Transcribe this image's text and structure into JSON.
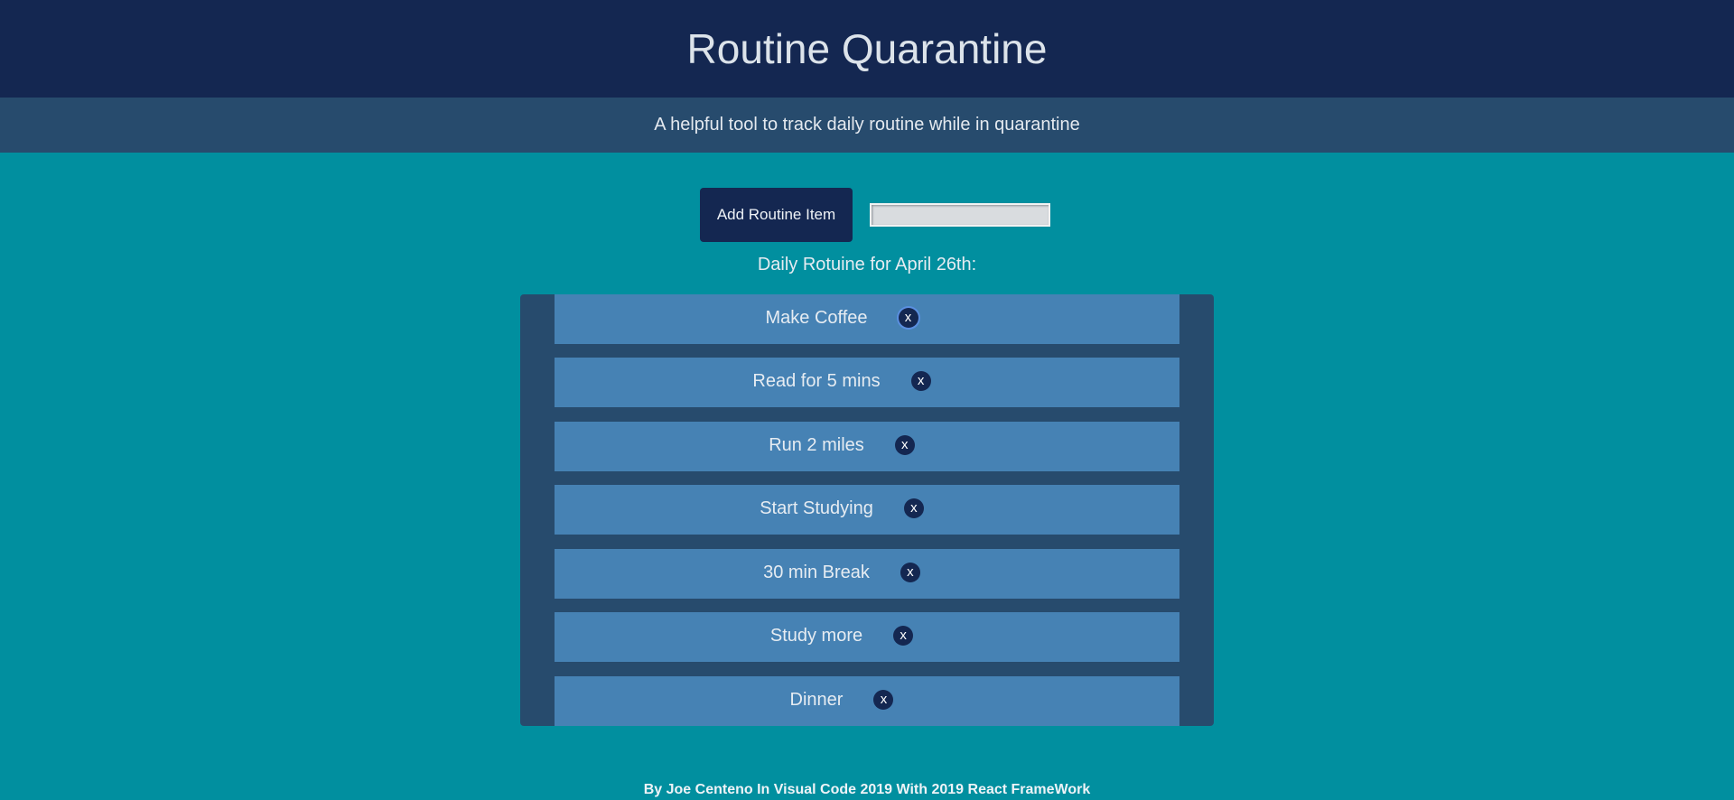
{
  "header": {
    "title": "Routine Quarantine"
  },
  "subheader": {
    "text": "A helpful tool to track daily routine while in quarantine"
  },
  "controls": {
    "add_button_label": "Add Routine Item",
    "input_value": "",
    "input_placeholder": ""
  },
  "list": {
    "heading": "Daily Rotuine for April 26th:",
    "delete_label": "x",
    "items": [
      {
        "label": "Make Coffee"
      },
      {
        "label": "Read for 5 mins"
      },
      {
        "label": "Run 2 miles"
      },
      {
        "label": "Start Studying"
      },
      {
        "label": "30 min Break"
      },
      {
        "label": "Study more"
      },
      {
        "label": "Dinner"
      }
    ]
  },
  "footer": {
    "text": "By Joe Centeno In Visual Code 2019 With 2019 React FrameWork"
  }
}
